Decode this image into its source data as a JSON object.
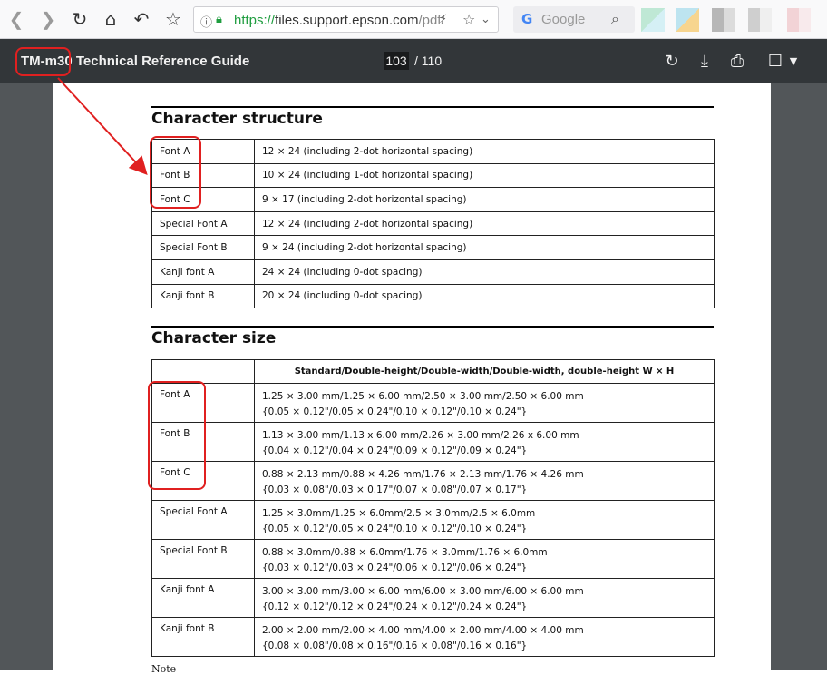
{
  "browser": {
    "url_scheme": "https://",
    "url_host": "files.support.epson.com",
    "url_path": "/pdf/",
    "search_placeholder": "Google"
  },
  "pdf_toolbar": {
    "title": "TM-m30 Technical Reference Guide",
    "current_page": "103",
    "total_pages": "/ 110"
  },
  "structure_section": {
    "title": "Character structure",
    "rows": [
      {
        "font": "Font A",
        "spec": "12 × 24 (including 2-dot horizontal spacing)"
      },
      {
        "font": "Font B",
        "spec": "10 × 24 (including 1-dot horizontal spacing)"
      },
      {
        "font": "Font C",
        "spec": "9 × 17 (including 2-dot horizontal spacing)"
      },
      {
        "font": "Special Font A",
        "spec": "12 × 24 (including 2-dot horizontal spacing)"
      },
      {
        "font": "Special Font B",
        "spec": "9 × 24 (including 2-dot horizontal spacing)"
      },
      {
        "font": "Kanji font A",
        "spec": "24 × 24 (including 0-dot spacing)"
      },
      {
        "font": "Kanji font B",
        "spec": "20 × 24 (including 0-dot spacing)"
      }
    ]
  },
  "size_section": {
    "title": "Character size",
    "header": "Standard/Double-height/Double-width/Double-width, double-height W × H",
    "rows": [
      {
        "font": "Font A",
        "mm": "1.25 × 3.00 mm/1.25 × 6.00 mm/2.50 × 3.00 mm/2.50 × 6.00 mm",
        "inch": "{0.05 × 0.12\"/0.05 × 0.24\"/0.10 × 0.12\"/0.10 × 0.24\"}"
      },
      {
        "font": "Font B",
        "mm": "1.13 × 3.00 mm/1.13 x 6.00 mm/2.26 × 3.00 mm/2.26 x 6.00 mm",
        "inch": "{0.04 × 0.12\"/0.04 × 0.24\"/0.09 × 0.12\"/0.09 × 0.24\"}"
      },
      {
        "font": "Font C",
        "mm": "0.88 × 2.13 mm/0.88 × 4.26 mm/1.76 × 2.13 mm/1.76 × 4.26 mm",
        "inch": "{0.03 × 0.08\"/0.03 × 0.17\"/0.07 × 0.08\"/0.07 × 0.17\"}"
      },
      {
        "font": "Special Font A",
        "mm": "1.25 × 3.0mm/1.25 × 6.0mm/2.5 × 3.0mm/2.5 × 6.0mm",
        "inch": "{0.05 × 0.12\"/0.05 × 0.24\"/0.10 × 0.12\"/0.10 × 0.24\"}"
      },
      {
        "font": "Special Font B",
        "mm": "0.88 × 3.0mm/0.88 × 6.0mm/1.76 × 3.0mm/1.76 × 6.0mm",
        "inch": "{0.03 × 0.12\"/0.03 × 0.24\"/0.06 × 0.12\"/0.06 × 0.24\"}"
      },
      {
        "font": "Kanji font A",
        "mm": "3.00 × 3.00 mm/3.00 × 6.00 mm/6.00 × 3.00 mm/6.00 × 6.00 mm",
        "inch": "{0.12 × 0.12\"/0.12 × 0.24\"/0.24 × 0.12\"/0.24 × 0.24\"}"
      },
      {
        "font": "Kanji font B",
        "mm": "2.00 × 2.00 mm/2.00 × 4.00 mm/4.00 × 2.00 mm/4.00 × 4.00 mm",
        "inch": "{0.08 × 0.08\"/0.08 × 0.16\"/0.16 × 0.08\"/0.16 × 0.16\"}"
      }
    ]
  },
  "footer_fragment": "Note",
  "colors": {
    "annotation": "#e02020",
    "pdf_toolbar_bg": "#323639",
    "viewer_bg": "#525659",
    "url_secure_green": "#1f9d3f"
  }
}
